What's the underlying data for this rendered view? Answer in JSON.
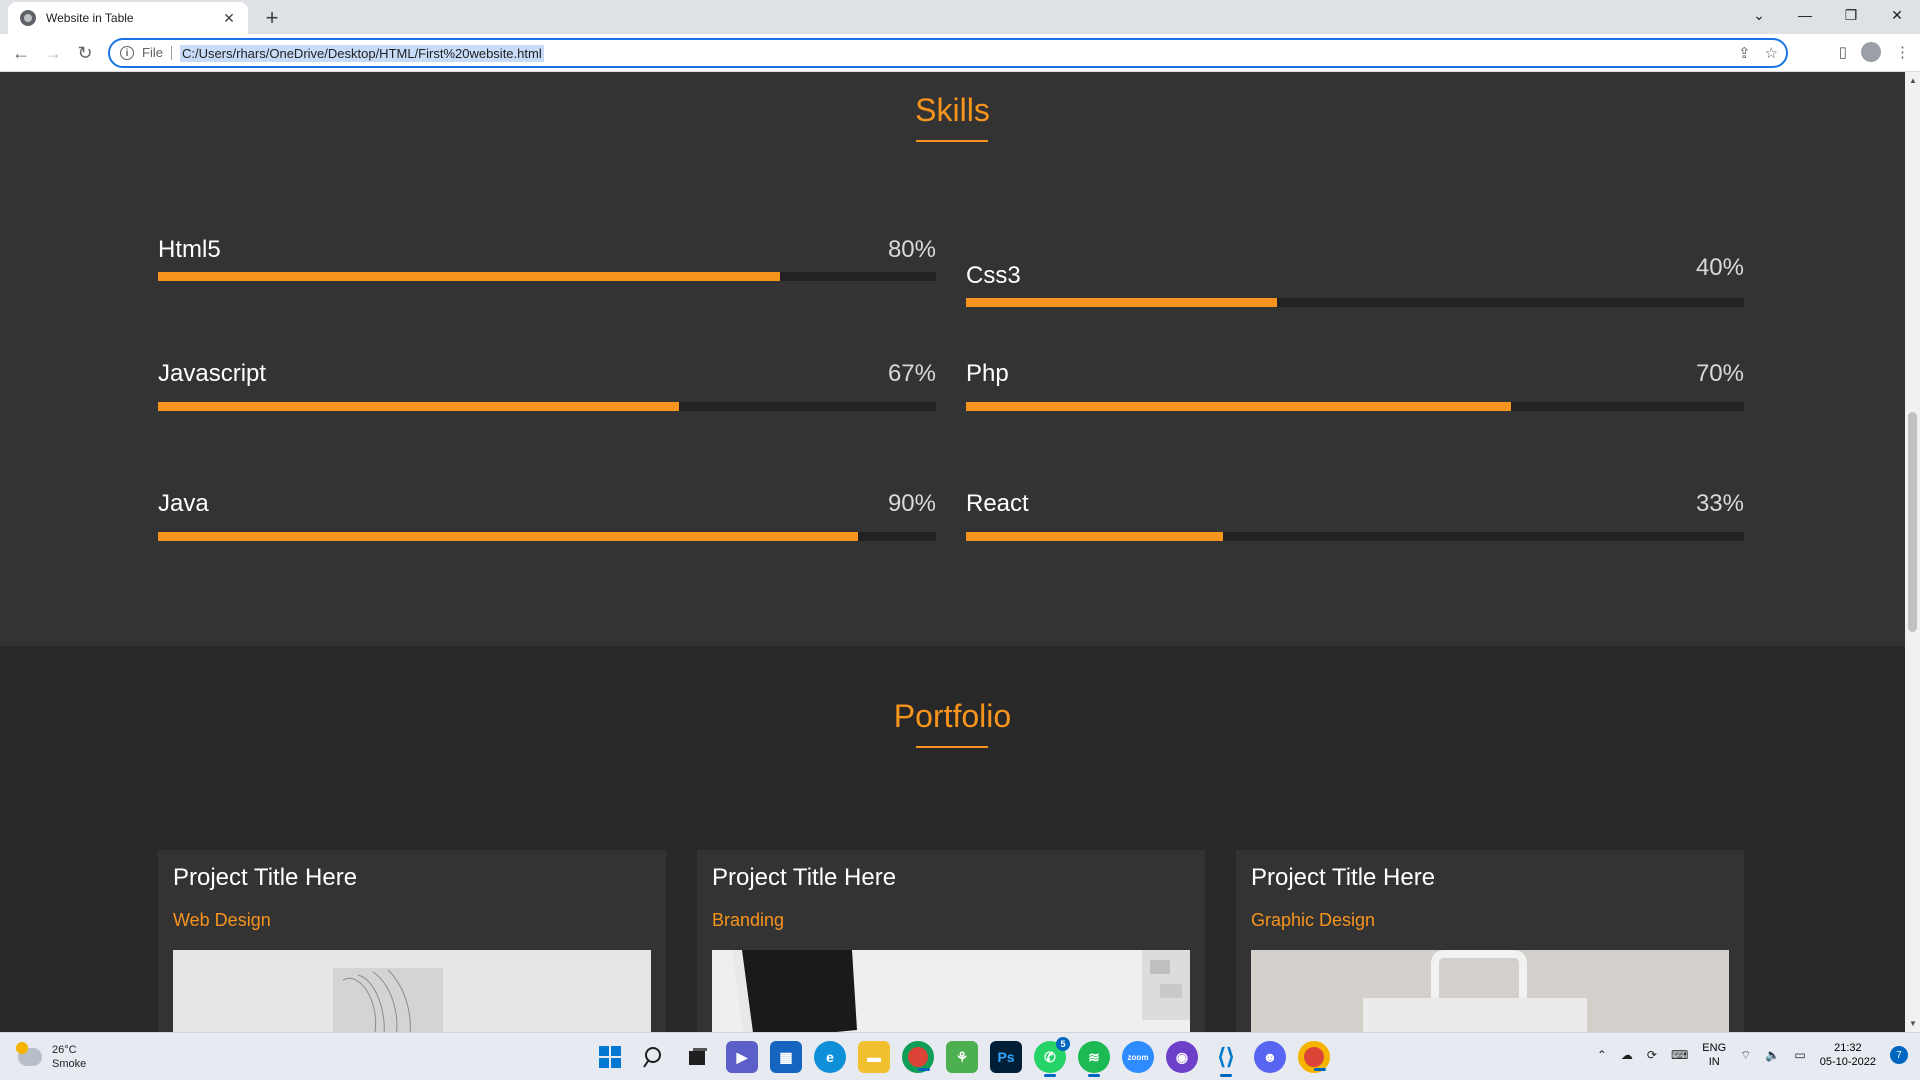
{
  "browser": {
    "tab_title": "Website in Table",
    "tab_close": "✕",
    "new_tab": "+",
    "url_scheme": "File",
    "url": "C:/Users/rhars/OneDrive/Desktop/HTML/First%20website.html"
  },
  "skills": {
    "title": "Skills",
    "items": [
      {
        "name": "Html5",
        "pct_label": "80%",
        "value": 0.8
      },
      {
        "name": "Css3",
        "pct_label": "40%",
        "value": 0.4
      },
      {
        "name": "Javascript",
        "pct_label": "67%",
        "value": 0.67
      },
      {
        "name": "Php",
        "pct_label": "70%",
        "value": 0.7
      },
      {
        "name": "Java",
        "pct_label": "90%",
        "value": 0.9
      },
      {
        "name": "React",
        "pct_label": "33%",
        "value": 0.33
      }
    ]
  },
  "portfolio": {
    "title": "Portfolio",
    "cards": [
      {
        "title": "Project Title Here",
        "category": "Web Design"
      },
      {
        "title": "Project Title Here",
        "category": "Branding"
      },
      {
        "title": "Project Title Here",
        "category": "Graphic Design"
      }
    ]
  },
  "colors": {
    "accent": "#f7941d",
    "skills_bg": "#333333",
    "portfolio_bg": "#282828"
  },
  "taskbar": {
    "weather_temp": "26°C",
    "weather_desc": "Smoke",
    "lang_line1": "ENG",
    "lang_line2": "IN",
    "time": "21:32",
    "date": "05-10-2022",
    "notification_count": "7",
    "whatsapp_badge": "5",
    "apps": [
      "windows-start-icon",
      "search-icon",
      "task-view-icon",
      "teams-chat-icon",
      "store-icon",
      "edge-icon",
      "file-explorer-icon",
      "chrome-icon",
      "app-icon",
      "photoshop-icon",
      "whatsapp-icon",
      "spotify-icon",
      "zoom-icon",
      "github-icon",
      "vscode-icon",
      "discord-icon",
      "chrome-active-icon"
    ]
  }
}
